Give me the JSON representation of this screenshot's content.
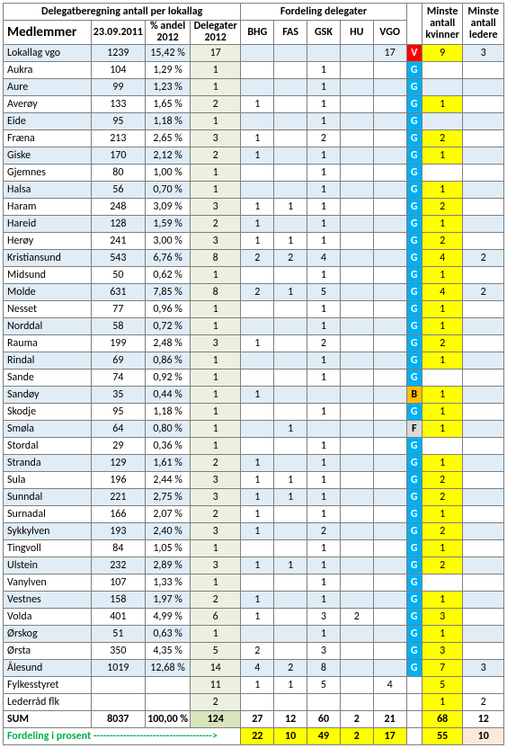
{
  "header": {
    "delegat_title": "Delegatberegning antall per lokallag",
    "fordeling_title": "Fordeling delegater",
    "minste_kvinner": "Minste antall kvinner",
    "minste_ledere": "Minste antall ledere",
    "medlemmer": "Medlemmer",
    "date": "23.09.2011",
    "andel": "% andel 2012",
    "delegater": "Delegater 2012",
    "cols": [
      "BHG",
      "FAS",
      "GSK",
      "HU",
      "VGO"
    ]
  },
  "rows": [
    {
      "name": "Lokallag vgo",
      "med": "1239",
      "andel": "15,42 %",
      "del": "17",
      "bhg": "",
      "fas": "",
      "gsk": "",
      "hu": "",
      "vgo": "17",
      "flag": "V",
      "kv": "9",
      "le": "3",
      "stripe": true,
      "flagCls": "flagV"
    },
    {
      "name": "Aukra",
      "med": "104",
      "andel": "1,29 %",
      "del": "1",
      "bhg": "",
      "fas": "",
      "gsk": "1",
      "hu": "",
      "vgo": "",
      "flag": "G",
      "kv": "",
      "le": "",
      "stripe": false,
      "flagCls": "flagG"
    },
    {
      "name": "Aure",
      "med": "99",
      "andel": "1,23 %",
      "del": "1",
      "bhg": "",
      "fas": "",
      "gsk": "1",
      "hu": "",
      "vgo": "",
      "flag": "G",
      "kv": "",
      "le": "",
      "stripe": true,
      "flagCls": "flagG"
    },
    {
      "name": "Averøy",
      "med": "133",
      "andel": "1,65 %",
      "del": "2",
      "bhg": "1",
      "fas": "",
      "gsk": "1",
      "hu": "",
      "vgo": "",
      "flag": "G",
      "kv": "1",
      "le": "",
      "stripe": false,
      "flagCls": "flagG"
    },
    {
      "name": "Eide",
      "med": "95",
      "andel": "1,18 %",
      "del": "1",
      "bhg": "",
      "fas": "",
      "gsk": "1",
      "hu": "",
      "vgo": "",
      "flag": "G",
      "kv": "",
      "le": "",
      "stripe": true,
      "flagCls": "flagG"
    },
    {
      "name": "Fræna",
      "med": "213",
      "andel": "2,65 %",
      "del": "3",
      "bhg": "1",
      "fas": "",
      "gsk": "2",
      "hu": "",
      "vgo": "",
      "flag": "G",
      "kv": "2",
      "le": "",
      "stripe": false,
      "flagCls": "flagG"
    },
    {
      "name": "Giske",
      "med": "170",
      "andel": "2,12 %",
      "del": "2",
      "bhg": "1",
      "fas": "",
      "gsk": "1",
      "hu": "",
      "vgo": "",
      "flag": "G",
      "kv": "1",
      "le": "",
      "stripe": true,
      "flagCls": "flagG"
    },
    {
      "name": "Gjemnes",
      "med": "80",
      "andel": "1,00 %",
      "del": "1",
      "bhg": "",
      "fas": "",
      "gsk": "1",
      "hu": "",
      "vgo": "",
      "flag": "G",
      "kv": "",
      "le": "",
      "stripe": false,
      "flagCls": "flagG"
    },
    {
      "name": "Halsa",
      "med": "56",
      "andel": "0,70 %",
      "del": "1",
      "bhg": "",
      "fas": "",
      "gsk": "1",
      "hu": "",
      "vgo": "",
      "flag": "G",
      "kv": "1",
      "le": "",
      "stripe": true,
      "flagCls": "flagG"
    },
    {
      "name": "Haram",
      "med": "248",
      "andel": "3,09 %",
      "del": "3",
      "bhg": "1",
      "fas": "1",
      "gsk": "1",
      "hu": "",
      "vgo": "",
      "flag": "G",
      "kv": "2",
      "le": "",
      "stripe": false,
      "flagCls": "flagG"
    },
    {
      "name": "Hareid",
      "med": "128",
      "andel": "1,59 %",
      "del": "2",
      "bhg": "1",
      "fas": "",
      "gsk": "1",
      "hu": "",
      "vgo": "",
      "flag": "G",
      "kv": "1",
      "le": "",
      "stripe": true,
      "flagCls": "flagG"
    },
    {
      "name": "Herøy",
      "med": "241",
      "andel": "3,00 %",
      "del": "3",
      "bhg": "1",
      "fas": "1",
      "gsk": "1",
      "hu": "",
      "vgo": "",
      "flag": "G",
      "kv": "2",
      "le": "",
      "stripe": false,
      "flagCls": "flagG"
    },
    {
      "name": "Kristiansund",
      "med": "543",
      "andel": "6,76 %",
      "del": "8",
      "bhg": "2",
      "fas": "2",
      "gsk": "4",
      "hu": "",
      "vgo": "",
      "flag": "G",
      "kv": "4",
      "le": "2",
      "stripe": true,
      "flagCls": "flagG"
    },
    {
      "name": "Midsund",
      "med": "50",
      "andel": "0,62 %",
      "del": "1",
      "bhg": "",
      "fas": "",
      "gsk": "1",
      "hu": "",
      "vgo": "",
      "flag": "G",
      "kv": "1",
      "le": "",
      "stripe": false,
      "flagCls": "flagG"
    },
    {
      "name": "Molde",
      "med": "631",
      "andel": "7,85 %",
      "del": "8",
      "bhg": "2",
      "fas": "1",
      "gsk": "5",
      "hu": "",
      "vgo": "",
      "flag": "G",
      "kv": "4",
      "le": "2",
      "stripe": true,
      "flagCls": "flagG"
    },
    {
      "name": "Nesset",
      "med": "77",
      "andel": "0,96 %",
      "del": "1",
      "bhg": "",
      "fas": "",
      "gsk": "1",
      "hu": "",
      "vgo": "",
      "flag": "G",
      "kv": "1",
      "le": "",
      "stripe": false,
      "flagCls": "flagG"
    },
    {
      "name": "Norddal",
      "med": "58",
      "andel": "0,72 %",
      "del": "1",
      "bhg": "",
      "fas": "",
      "gsk": "1",
      "hu": "",
      "vgo": "",
      "flag": "G",
      "kv": "1",
      "le": "",
      "stripe": true,
      "flagCls": "flagG"
    },
    {
      "name": "Rauma",
      "med": "199",
      "andel": "2,48 %",
      "del": "3",
      "bhg": "1",
      "fas": "",
      "gsk": "2",
      "hu": "",
      "vgo": "",
      "flag": "G",
      "kv": "2",
      "le": "",
      "stripe": false,
      "flagCls": "flagG"
    },
    {
      "name": "Rindal",
      "med": "69",
      "andel": "0,86 %",
      "del": "1",
      "bhg": "",
      "fas": "",
      "gsk": "1",
      "hu": "",
      "vgo": "",
      "flag": "G",
      "kv": "1",
      "le": "",
      "stripe": true,
      "flagCls": "flagG"
    },
    {
      "name": "Sande",
      "med": "74",
      "andel": "0,92 %",
      "del": "1",
      "bhg": "",
      "fas": "",
      "gsk": "1",
      "hu": "",
      "vgo": "",
      "flag": "G",
      "kv": "",
      "le": "",
      "stripe": false,
      "flagCls": "flagG"
    },
    {
      "name": "Sandøy",
      "med": "35",
      "andel": "0,44 %",
      "del": "1",
      "bhg": "1",
      "fas": "",
      "gsk": "",
      "hu": "",
      "vgo": "",
      "flag": "B",
      "kv": "1",
      "le": "",
      "stripe": true,
      "flagCls": "flagB"
    },
    {
      "name": "Skodje",
      "med": "95",
      "andel": "1,18 %",
      "del": "1",
      "bhg": "",
      "fas": "",
      "gsk": "1",
      "hu": "",
      "vgo": "",
      "flag": "G",
      "kv": "1",
      "le": "",
      "stripe": false,
      "flagCls": "flagG"
    },
    {
      "name": "Smøla",
      "med": "64",
      "andel": "0,80 %",
      "del": "1",
      "bhg": "",
      "fas": "1",
      "gsk": "",
      "hu": "",
      "vgo": "",
      "flag": "F",
      "kv": "1",
      "le": "",
      "stripe": true,
      "flagCls": "flagF"
    },
    {
      "name": "Stordal",
      "med": "29",
      "andel": "0,36 %",
      "del": "1",
      "bhg": "",
      "fas": "",
      "gsk": "1",
      "hu": "",
      "vgo": "",
      "flag": "G",
      "kv": "",
      "le": "",
      "stripe": false,
      "flagCls": "flagG"
    },
    {
      "name": "Stranda",
      "med": "129",
      "andel": "1,61 %",
      "del": "2",
      "bhg": "1",
      "fas": "",
      "gsk": "1",
      "hu": "",
      "vgo": "",
      "flag": "G",
      "kv": "1",
      "le": "",
      "stripe": true,
      "flagCls": "flagG"
    },
    {
      "name": "Sula",
      "med": "196",
      "andel": "2,44 %",
      "del": "3",
      "bhg": "1",
      "fas": "1",
      "gsk": "1",
      "hu": "",
      "vgo": "",
      "flag": "G",
      "kv": "2",
      "le": "",
      "stripe": false,
      "flagCls": "flagG"
    },
    {
      "name": "Sunndal",
      "med": "221",
      "andel": "2,75 %",
      "del": "3",
      "bhg": "1",
      "fas": "1",
      "gsk": "1",
      "hu": "",
      "vgo": "",
      "flag": "G",
      "kv": "2",
      "le": "",
      "stripe": true,
      "flagCls": "flagG"
    },
    {
      "name": "Surnadal",
      "med": "166",
      "andel": "2,07 %",
      "del": "2",
      "bhg": "1",
      "fas": "",
      "gsk": "1",
      "hu": "",
      "vgo": "",
      "flag": "G",
      "kv": "1",
      "le": "",
      "stripe": false,
      "flagCls": "flagG"
    },
    {
      "name": "Sykkylven",
      "med": "193",
      "andel": "2,40 %",
      "del": "3",
      "bhg": "1",
      "fas": "",
      "gsk": "2",
      "hu": "",
      "vgo": "",
      "flag": "G",
      "kv": "2",
      "le": "",
      "stripe": true,
      "flagCls": "flagG"
    },
    {
      "name": "Tingvoll",
      "med": "84",
      "andel": "1,05 %",
      "del": "1",
      "bhg": "",
      "fas": "",
      "gsk": "1",
      "hu": "",
      "vgo": "",
      "flag": "G",
      "kv": "1",
      "le": "",
      "stripe": false,
      "flagCls": "flagG"
    },
    {
      "name": "Ulstein",
      "med": "232",
      "andel": "2,89 %",
      "del": "3",
      "bhg": "1",
      "fas": "1",
      "gsk": "1",
      "hu": "",
      "vgo": "",
      "flag": "G",
      "kv": "2",
      "le": "",
      "stripe": true,
      "flagCls": "flagG"
    },
    {
      "name": "Vanylven",
      "med": "107",
      "andel": "1,33 %",
      "del": "1",
      "bhg": "",
      "fas": "",
      "gsk": "1",
      "hu": "",
      "vgo": "",
      "flag": "G",
      "kv": "",
      "le": "",
      "stripe": false,
      "flagCls": "flagG"
    },
    {
      "name": "Vestnes",
      "med": "158",
      "andel": "1,97 %",
      "del": "2",
      "bhg": "1",
      "fas": "",
      "gsk": "1",
      "hu": "",
      "vgo": "",
      "flag": "G",
      "kv": "1",
      "le": "",
      "stripe": true,
      "flagCls": "flagG"
    },
    {
      "name": "Volda",
      "med": "401",
      "andel": "4,99 %",
      "del": "6",
      "bhg": "1",
      "fas": "",
      "gsk": "3",
      "hu": "2",
      "vgo": "",
      "flag": "G",
      "kv": "3",
      "le": "",
      "stripe": false,
      "flagCls": "flagG"
    },
    {
      "name": "Ørskog",
      "med": "51",
      "andel": "0,63 %",
      "del": "1",
      "bhg": "",
      "fas": "",
      "gsk": "1",
      "hu": "",
      "vgo": "",
      "flag": "G",
      "kv": "1",
      "le": "",
      "stripe": true,
      "flagCls": "flagG"
    },
    {
      "name": "Ørsta",
      "med": "350",
      "andel": "4,35 %",
      "del": "5",
      "bhg": "2",
      "fas": "",
      "gsk": "3",
      "hu": "",
      "vgo": "",
      "flag": "G",
      "kv": "3",
      "le": "",
      "stripe": false,
      "flagCls": "flagG"
    },
    {
      "name": "Ålesund",
      "med": "1019",
      "andel": "12,68 %",
      "del": "14",
      "bhg": "4",
      "fas": "2",
      "gsk": "8",
      "hu": "",
      "vgo": "",
      "flag": "G",
      "kv": "7",
      "le": "3",
      "stripe": true,
      "flagCls": "flagG"
    }
  ],
  "extra": [
    {
      "name": "Fylkesstyret",
      "del": "11",
      "bhg": "1",
      "fas": "1",
      "gsk": "5",
      "hu": "",
      "vgo": "4",
      "kv": "5",
      "le": ""
    },
    {
      "name": "Lederråd flk",
      "del": "2",
      "bhg": "",
      "fas": "",
      "gsk": "",
      "hu": "",
      "vgo": "",
      "kv": "1",
      "le": "2"
    }
  ],
  "sum": {
    "label": "SUM",
    "med": "8037",
    "andel": "100,00 %",
    "del": "124",
    "bhg": "27",
    "fas": "12",
    "gsk": "60",
    "hu": "2",
    "vgo": "21",
    "kv": "68",
    "le": "12"
  },
  "prosent": {
    "label": "Fordeling i prosent",
    "arrow": "------------------------------------>",
    "bhg": "22",
    "fas": "10",
    "gsk": "49",
    "hu": "2",
    "vgo": "17",
    "kv": "55",
    "le": "10"
  }
}
